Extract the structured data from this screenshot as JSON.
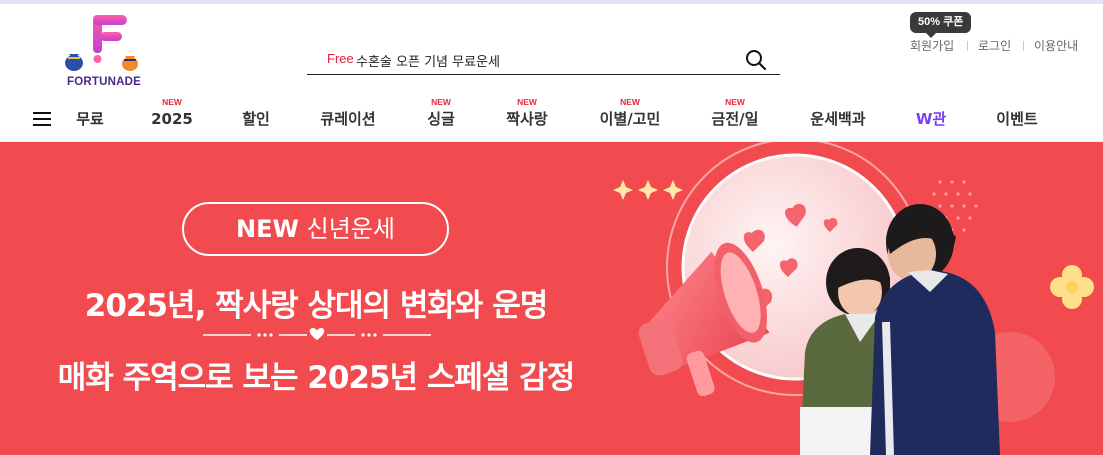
{
  "header": {
    "logo_text": "FORTUNADE",
    "search": {
      "prefix": "Free",
      "text": "수혼술 오픈 기념 무료운세"
    },
    "coupon_badge": "50% 쿠폰",
    "util_links": [
      "회원가입",
      "로그인",
      "이용안내"
    ]
  },
  "nav": {
    "new_badge": "NEW",
    "items": [
      {
        "label": "무료",
        "is_new": false
      },
      {
        "label": "2025",
        "is_new": true
      },
      {
        "label": "할인",
        "is_new": false
      },
      {
        "label": "큐레이션",
        "is_new": false
      },
      {
        "label": "싱글",
        "is_new": true
      },
      {
        "label": "짝사랑",
        "is_new": true
      },
      {
        "label": "이별/고민",
        "is_new": true
      },
      {
        "label": "금전/일",
        "is_new": true
      },
      {
        "label": "운세백과",
        "is_new": false
      },
      {
        "label": "W관",
        "is_new": false
      },
      {
        "label": "이벤트",
        "is_new": false
      }
    ]
  },
  "banner": {
    "pill_new": "NEW",
    "pill_text": "신년운세",
    "headline_1": "2025년, 짝사랑 상대의 변화와 운명",
    "headline_2": "매화 주역으로 보는 2025년 스페셜 감정"
  },
  "colors": {
    "brand_purple": "#4a2a86",
    "banner_red": "#f24b4f",
    "new_red": "#e8283c",
    "w_purple": "#7a3df0"
  }
}
